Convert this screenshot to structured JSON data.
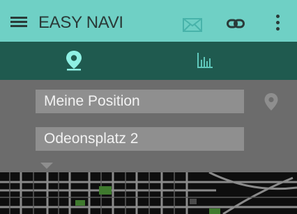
{
  "app": {
    "title": "EASY NAVI"
  },
  "toolbar": {
    "menu_icon": "hamburger-icon",
    "mail_icon": "envelope-icon",
    "link_icon": "link-icon",
    "more_icon": "more-vertical-icon"
  },
  "tabs": [
    {
      "icon": "map-pin-icon",
      "selected": true
    },
    {
      "icon": "bar-chart-icon",
      "selected": false
    }
  ],
  "route": {
    "from_value": "Meine Position",
    "to_value": "Odeonsplatz 2",
    "locate_icon": "map-pin-icon",
    "expand_icon": "triangle-down-icon"
  },
  "colors": {
    "appbar": "#6fd0c5",
    "tabbar": "#1f5a4f",
    "tab_icon": "#8ff0e4",
    "panel": "#6c6c6c",
    "field": "#8f8f8f",
    "map": "#0e0e0e"
  }
}
